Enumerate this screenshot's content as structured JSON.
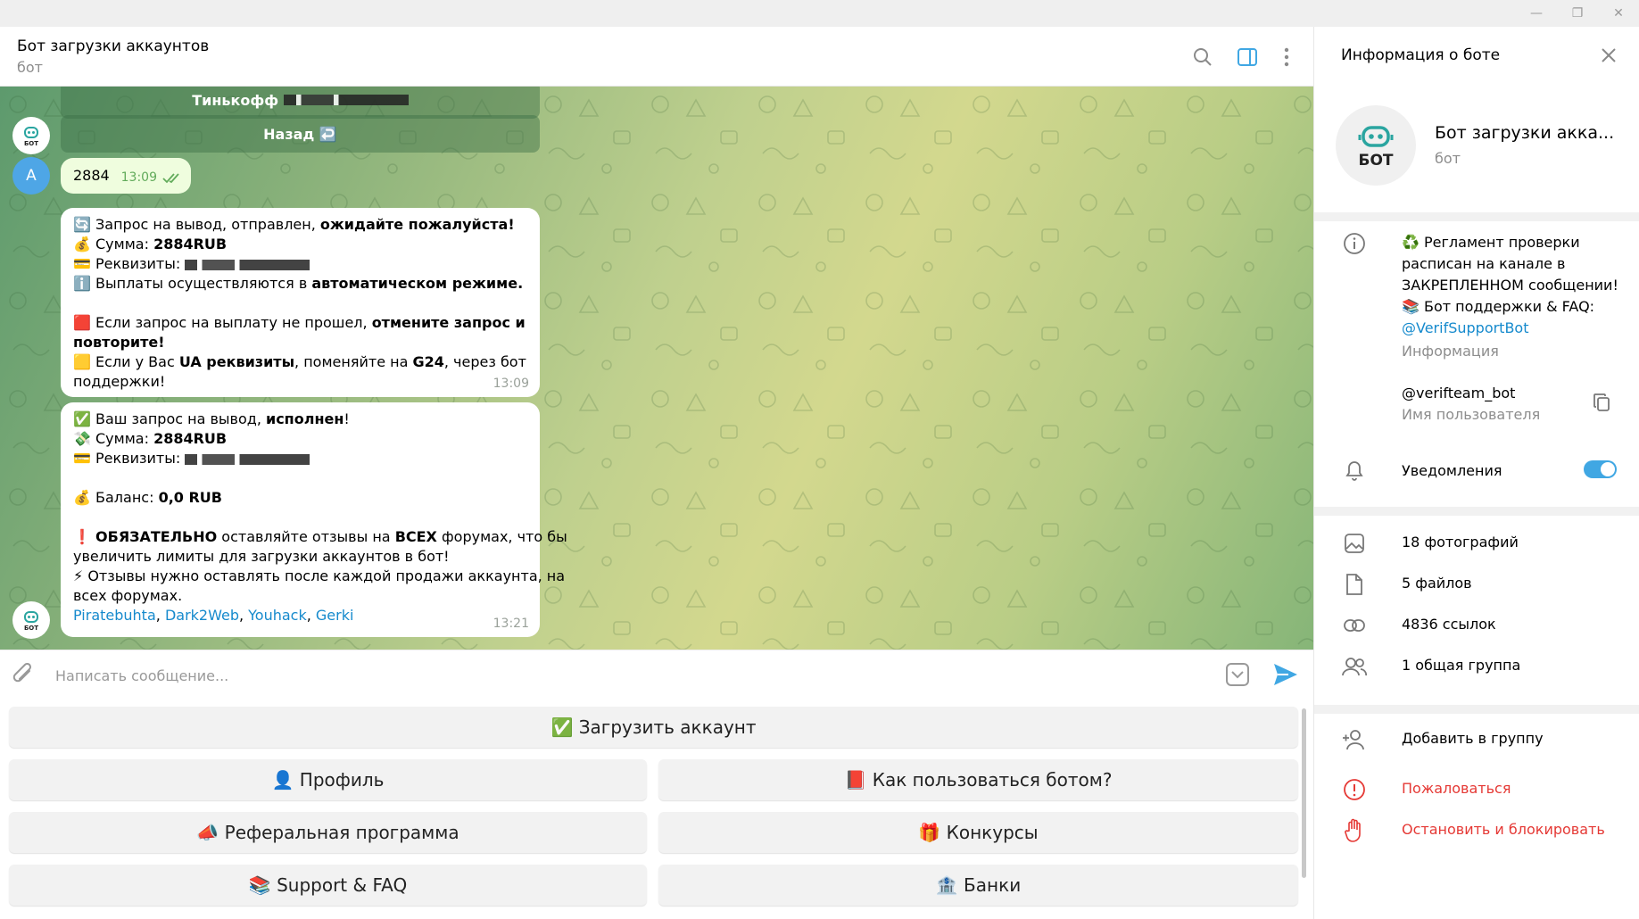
{
  "window": {
    "controls": [
      "minimize",
      "restore",
      "close"
    ]
  },
  "header": {
    "title": "Бот загрузки аккаунтов",
    "subtitle": "бот"
  },
  "messages": {
    "inline_buttons": [
      "Тинькофф",
      "Назад ↩️"
    ],
    "user_msg": {
      "text": "2884",
      "time": "13:09",
      "avatar": "A"
    },
    "bot_msg1": {
      "l1a": "🔄 Запрос на вывод,  отправлен, ",
      "l1b": "ожидайте пожалуйста!",
      "l2a": "💰 Сумма: ",
      "l2b": "2884RUB",
      "l3a": "💳 Реквизиты: ",
      "l4a": "ℹ️ Выплаты осуществляются в ",
      "l4b": "автоматическом режиме.",
      "l5a": "🟥 Если запрос на выплату не прошел, ",
      "l5b": "отмените запрос и",
      "l6b": "повторите!",
      "l7a": "🟨 Если у Вас ",
      "l7b": "UA реквизиты",
      "l7c": ", поменяйте на ",
      "l7d": "G24",
      "l7e": ", через бот",
      "l8a": "поддержки!",
      "time": "13:09"
    },
    "bot_msg2": {
      "l1a": "✅ Ваш запрос на вывод, ",
      "l1b": "исполнен",
      "l1c": "!",
      "l2a": "💸 Сумма: ",
      "l2b": "2884RUB",
      "l3a": "💳 Реквизиты: ",
      "l4a": "💰 Баланс: ",
      "l4b": "0,0 RUB",
      "l5a": "❗ ",
      "l5b": "ОБЯЗАТЕЛЬНО",
      "l5c": " оставляйте отзывы на ",
      "l5d": "ВСЕХ",
      "l5e": " форумах, что бы",
      "l6a": "увеличить лимиты для загрузки аккаунтов в бот!",
      "l7a": "⚡ Отзывы нужно оставлять после каждой продажи аккаунта, на",
      "l8a": "всех форумах.",
      "links": [
        "Piratebuhta",
        "Dark2Web",
        "Youhack",
        "Gerki"
      ],
      "time": "13:21"
    }
  },
  "input": {
    "placeholder": "Написать сообщение..."
  },
  "keyboard": {
    "row1": "✅ Загрузить аккаунт",
    "row2": [
      "👤 Профиль",
      "📕 Как пользоваться ботом?"
    ],
    "row3": [
      "📣 Реферальная программа",
      "🎁 Конкурсы"
    ],
    "row4": [
      "📚 Support & FAQ",
      "🏦 Банки"
    ]
  },
  "panel": {
    "title": "Информация о боте",
    "bot_name": "Бот загрузки акка...",
    "bot_status": "бот",
    "avatar_label": "БОТ",
    "info_lines": [
      "♻️ Регламент проверки",
      "расписан на канале в",
      "ЗАКРЕПЛЕННОМ сообщении!",
      "📚 Бот поддержки & FAQ:"
    ],
    "info_link": "@VerifSupportBot",
    "info_caption": "Информация",
    "username": "@verifteam_bot",
    "username_caption": "Имя пользователя",
    "notifications": "Уведомления",
    "notifications_on": true,
    "media": [
      "18 фотографий",
      "5 файлов",
      "4836 ссылок",
      "1 общая группа"
    ],
    "actions": {
      "add": "Добавить в группу",
      "report": "Пожаловаться",
      "block": "Остановить и блокировать"
    },
    "colors": {
      "accent": "#40a7e3",
      "danger": "#e53935"
    }
  }
}
